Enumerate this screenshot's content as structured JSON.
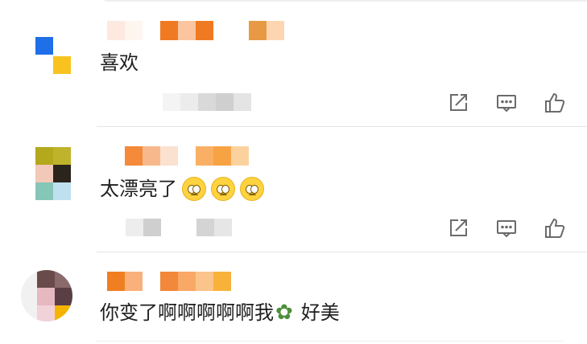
{
  "comments": [
    {
      "text": "喜欢"
    },
    {
      "text": "太漂亮了"
    },
    {
      "text": "你变了啊啊啊啊啊我",
      "text_after": "好美"
    }
  ],
  "colors": {
    "accent_orange": "#f28a2a",
    "divider": "#e4e4e4",
    "action_icon": "#6b6b6b"
  },
  "icons": {
    "share": "share-icon",
    "comment": "comment-icon",
    "like": "thumbs-up-icon",
    "emoji": "pleading-face-emoji",
    "leaf": "herb-emoji"
  }
}
